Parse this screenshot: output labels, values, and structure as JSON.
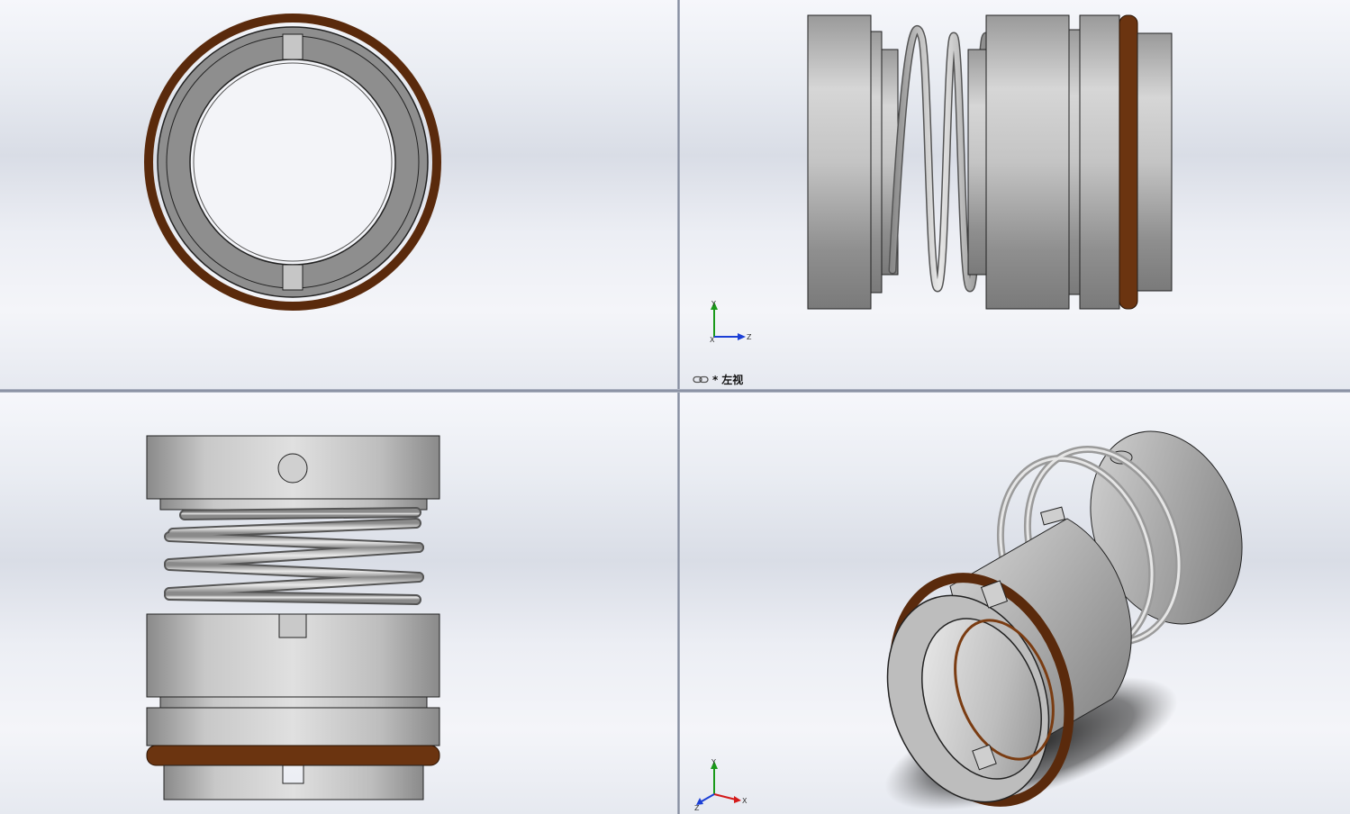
{
  "viewports": {
    "front": {},
    "left": {
      "label_prefix": "*",
      "label_text": "左视"
    },
    "top": {},
    "iso": {}
  },
  "triad": {
    "y_label": "Y",
    "z_label": "Z",
    "x_label": "X"
  },
  "colors": {
    "steel_light": "#d4d4d4",
    "steel_dark": "#8c8c8c",
    "oring": "#6b3410",
    "outline": "#222222",
    "axis_y": "#1a9a1a",
    "axis_z": "#1b3fd6",
    "axis_x": "#d41a1a"
  }
}
